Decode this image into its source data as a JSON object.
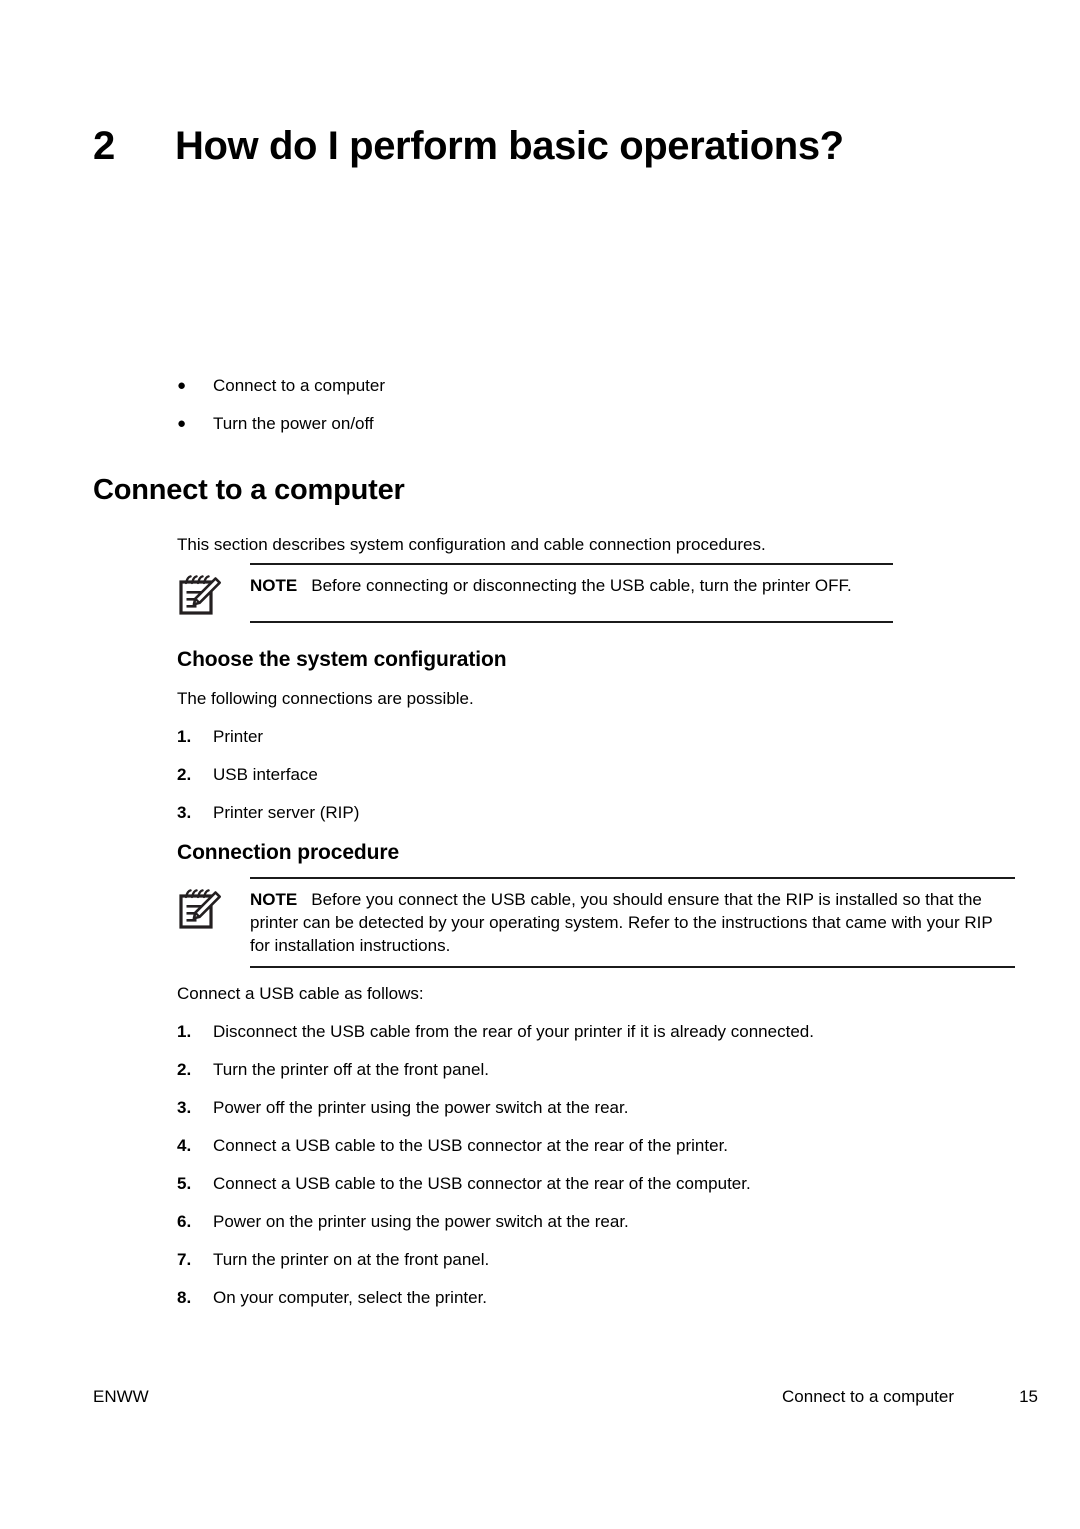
{
  "chapter": {
    "number": "2",
    "title": "How do I perform basic operations?"
  },
  "overview_bullets": [
    {
      "bullet": "●",
      "label": "Connect to a computer"
    },
    {
      "bullet": "●",
      "label": "Turn the power on/off"
    }
  ],
  "section": {
    "heading": "Connect to a computer",
    "intro": "This section describes system configuration and cable connection procedures.",
    "note_1": {
      "icon": "note-pencil-icon",
      "label": "NOTE",
      "text": "Before connecting or disconnecting the USB cable, turn the printer OFF."
    }
  },
  "subsection_config": {
    "heading": "Choose the system configuration",
    "intro": "The following connections are possible.",
    "items": [
      {
        "marker": "1.",
        "text": "Printer"
      },
      {
        "marker": "2.",
        "text": "USB interface"
      },
      {
        "marker": "3.",
        "text": "Printer server (RIP)"
      }
    ]
  },
  "subsection_procedure": {
    "heading": "Connection procedure",
    "note_2": {
      "icon": "note-pencil-icon",
      "label": "NOTE",
      "text": "Before you connect the USB cable, you should ensure that the RIP is installed so that the printer can be detected by your operating system. Refer to the instructions that came with your RIP for installation instructions."
    },
    "intro": "Connect a USB cable as follows:",
    "steps": [
      {
        "marker": "1.",
        "text": "Disconnect the USB cable from the rear of your printer if it is already connected."
      },
      {
        "marker": "2.",
        "text": "Turn the printer off at the front panel."
      },
      {
        "marker": "3.",
        "text": "Power off the printer using the power switch at the rear."
      },
      {
        "marker": "4.",
        "text": "Connect a USB cable to the USB connector at the rear of the printer."
      },
      {
        "marker": "5.",
        "text": "Connect a USB cable to the USB connector at the rear of the computer."
      },
      {
        "marker": "6.",
        "text": "Power on the printer using the power switch at the rear."
      },
      {
        "marker": "7.",
        "text": "Turn the printer on at the front panel."
      },
      {
        "marker": "8.",
        "text": "On your computer, select the printer."
      }
    ]
  },
  "footer": {
    "left": "ENWW",
    "section": "Connect to a computer",
    "page": "15"
  }
}
